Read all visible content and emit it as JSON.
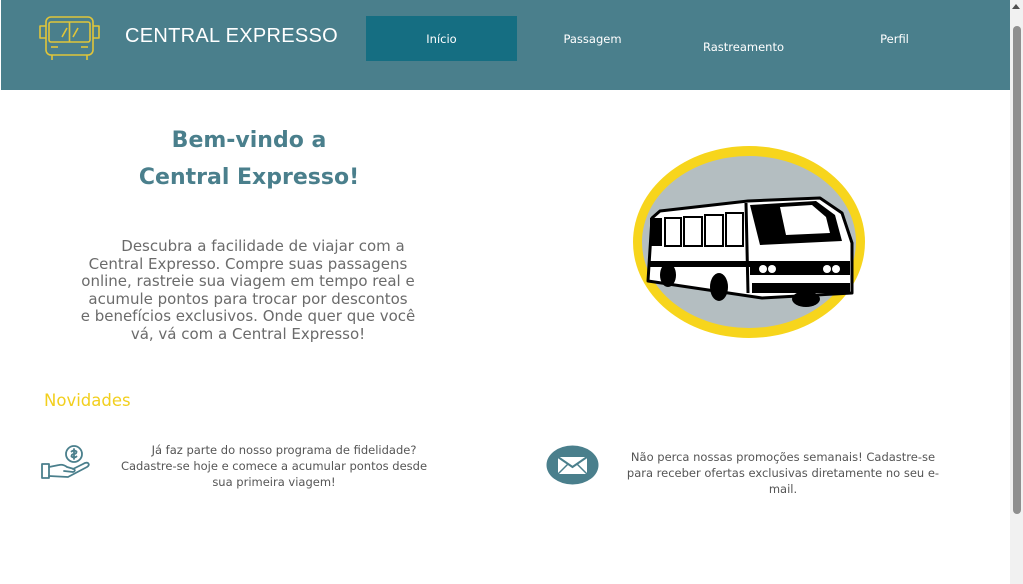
{
  "header": {
    "brand": "CENTRAL EXPRESSO",
    "logo_icon": "bus-icon",
    "background_color": "#4a7f8c",
    "active_color": "#156e82"
  },
  "nav": {
    "items": [
      {
        "label": "Início",
        "active": true
      },
      {
        "label": "Passagem",
        "active": false
      },
      {
        "label": "Rastreamento",
        "active": false
      },
      {
        "label": "Perfil",
        "active": false
      }
    ]
  },
  "hero": {
    "title_line1": "Bem-vindo a",
    "title_line2": "Central Expresso!",
    "text_lines": [
      "Descubra a facilidade de viajar com a",
      "Central Expresso. Compre suas passagens",
      "online, rastreie sua viagem em tempo real e",
      "acumule pontos para trocar por descontos",
      "e benefícios exclusivos. Onde quer que você",
      "vá, vá com a Central Expresso!"
    ],
    "illustration_icon": "bus-illustration"
  },
  "news": {
    "title": "Novidades",
    "accent_color": "#f2cf1e",
    "items": [
      {
        "icon": "hand-money-icon",
        "lines": [
          "Já faz parte do nosso programa de fidelidade?",
          "Cadastre-se hoje e comece a acumular pontos desde",
          "sua primeira viagem!"
        ]
      },
      {
        "icon": "mail-icon",
        "lines": [
          "Não perca nossas promoções semanais! Cadastre-se",
          "para receber ofertas exclusivas diretamente no seu e-",
          "mail."
        ]
      }
    ]
  }
}
